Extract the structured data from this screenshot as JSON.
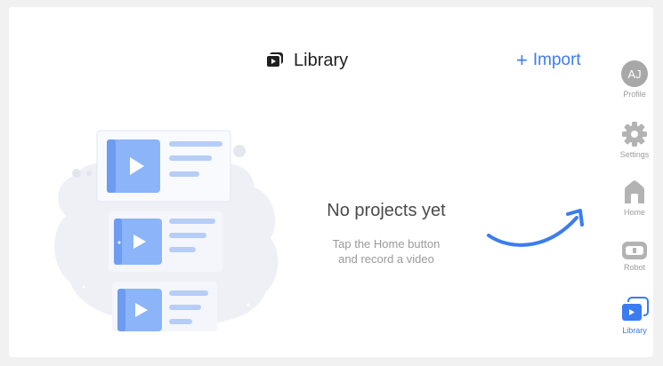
{
  "header": {
    "title": "Library",
    "import_label": "Import",
    "import_symbol": "+"
  },
  "empty_state": {
    "title": "No projects yet",
    "hint_line1": "Tap the Home button",
    "hint_line2": "and record a video"
  },
  "sidebar": {
    "items": [
      {
        "label": "Profile",
        "avatar_initials": "AJ",
        "icon": "profile-avatar"
      },
      {
        "label": "Settings",
        "icon": "gear-icon"
      },
      {
        "label": "Home",
        "icon": "home-icon"
      },
      {
        "label": "Robot",
        "icon": "robot-icon"
      },
      {
        "label": "Library",
        "icon": "library-icon",
        "active": true
      }
    ]
  },
  "colors": {
    "accent": "#3b7cf0",
    "inactive_icon": "#b3b3b3",
    "text_primary": "#1f1f1f",
    "text_secondary": "#9a9a9a"
  }
}
